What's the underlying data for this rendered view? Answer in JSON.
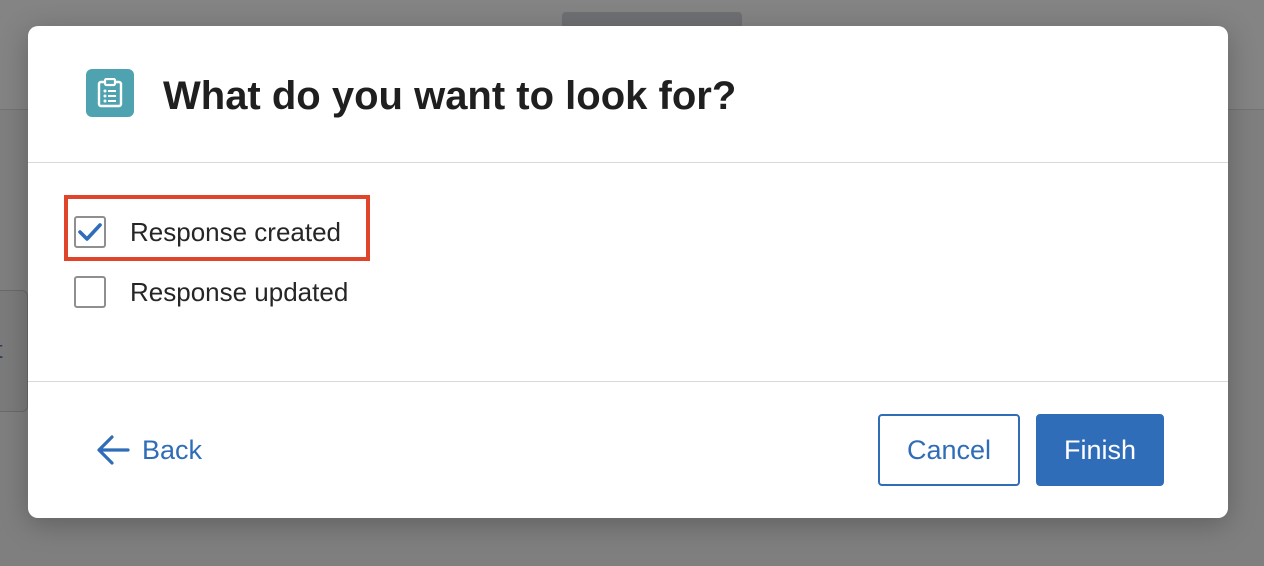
{
  "modal": {
    "icon": "clipboard-icon",
    "title": "What do you want to look for?"
  },
  "options": [
    {
      "label": "Response created",
      "checked": true
    },
    {
      "label": "Response updated",
      "checked": false
    }
  ],
  "footer": {
    "back_label": "Back",
    "cancel_label": "Cancel",
    "finish_label": "Finish"
  },
  "background": {
    "partial_text": "t"
  },
  "colors": {
    "accent": "#2f6db8",
    "icon_bg": "#4fa3b0",
    "highlight": "#e0452b",
    "overlay": "#7f7f80"
  }
}
